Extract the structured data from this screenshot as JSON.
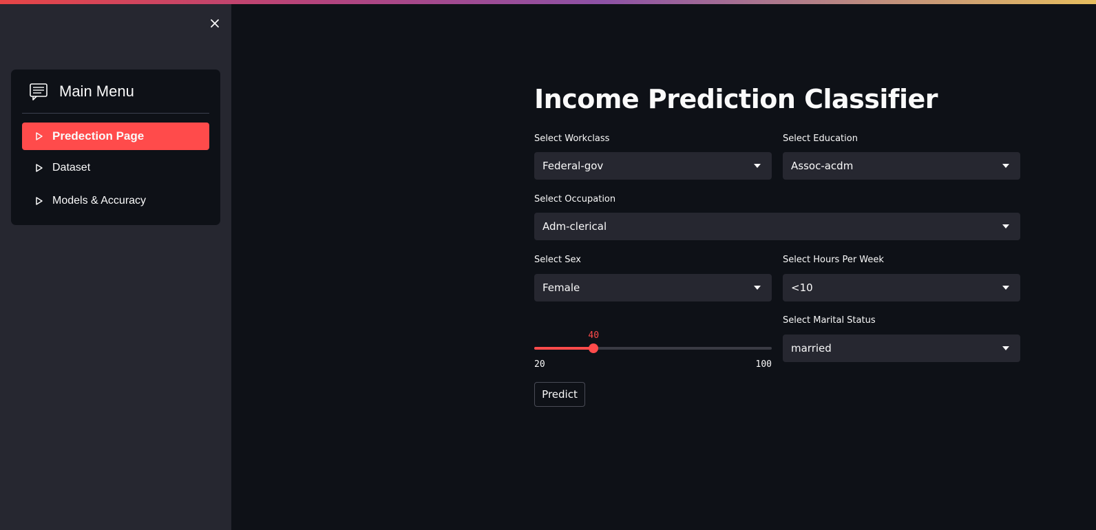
{
  "sidebar": {
    "menu_title": "Main Menu",
    "items": [
      {
        "label": "Predection Page",
        "active": true
      },
      {
        "label": "Dataset",
        "active": false
      },
      {
        "label": "Models & Accuracy",
        "active": false
      }
    ]
  },
  "main": {
    "title": "Income Prediction Classifier",
    "workclass": {
      "label": "Select Workclass",
      "value": "Federal-gov"
    },
    "education": {
      "label": "Select Education",
      "value": "Assoc-acdm"
    },
    "occupation": {
      "label": "Select Occupation",
      "value": "Adm-clerical"
    },
    "sex": {
      "label": "Select Sex",
      "value": "Female"
    },
    "hours": {
      "label": "Select Hours Per Week",
      "value": "<10"
    },
    "marital": {
      "label": "Select Marital Status",
      "value": "married"
    },
    "slider": {
      "value": 40,
      "min": 20,
      "max": 100,
      "value_text": "40",
      "min_text": "20",
      "max_text": "100"
    },
    "predict_label": "Predict"
  },
  "colors": {
    "accent": "#ff4b4b",
    "sidebar_bg": "#262730",
    "main_bg": "#0e1117"
  }
}
